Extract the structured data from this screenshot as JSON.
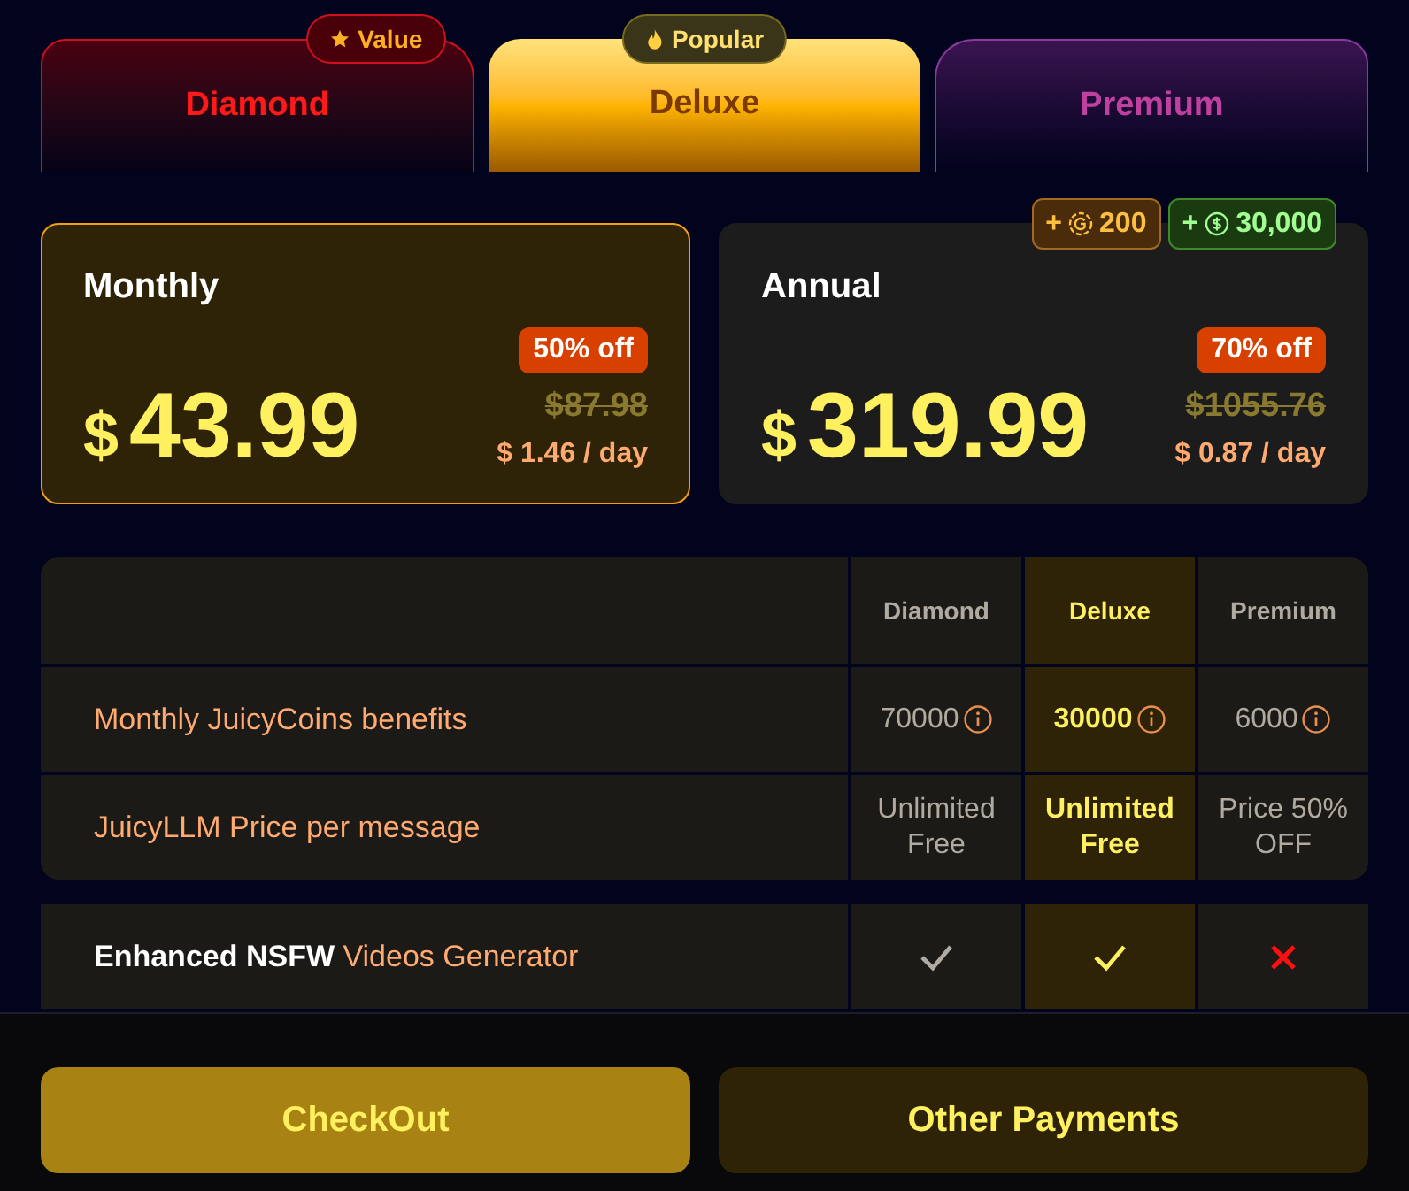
{
  "tabs": [
    {
      "label": "Diamond",
      "selected": false,
      "color": "#ff1a1a",
      "badge": {
        "kind": "star",
        "text": "Value"
      }
    },
    {
      "label": "Deluxe",
      "selected": true,
      "color": "#7a3a00",
      "badge": {
        "kind": "fire",
        "text": "Popular"
      }
    },
    {
      "label": "Premium",
      "selected": false,
      "color": "#c040a0"
    }
  ],
  "plans": [
    {
      "name": "Monthly",
      "selected": true,
      "currency": "$",
      "price": "43.99",
      "discount": "50% off",
      "old_price": "$87.98",
      "per_day": "$ 1.46 / day"
    },
    {
      "name": "Annual",
      "selected": false,
      "currency": "$",
      "price": "319.99",
      "discount": "70% off",
      "old_price": "$1055.76",
      "per_day": "$ 0.87 / day",
      "bonuses": [
        {
          "kind": "gold",
          "text": "+",
          "amount": "200"
        },
        {
          "kind": "cash",
          "text": "+",
          "amount": "30,000"
        }
      ]
    }
  ],
  "table": {
    "columns": [
      {
        "label": "Diamond",
        "selected": false
      },
      {
        "label": "Deluxe",
        "selected": true
      },
      {
        "label": "Premium",
        "selected": false
      }
    ],
    "rows": [
      {
        "label": "Monthly JuicyCoins benefits",
        "cells": [
          {
            "kind": "text",
            "text": "70000",
            "info": true
          },
          {
            "kind": "text",
            "text": "30000",
            "info": true
          },
          {
            "kind": "text",
            "text": "6000",
            "info": true
          }
        ]
      },
      {
        "label": "JuicyLLM Price per message",
        "cells": [
          {
            "kind": "text",
            "text": "Unlimited Free"
          },
          {
            "kind": "text",
            "text": "Unlimited Free"
          },
          {
            "kind": "text",
            "text": "Price 50% OFF"
          }
        ]
      }
    ],
    "feature_rows": [
      {
        "label": "Enhanced NSFW",
        "label_accent": "Videos Generator",
        "cells": [
          {
            "kind": "check"
          },
          {
            "kind": "check"
          },
          {
            "kind": "cross"
          }
        ]
      }
    ]
  },
  "buttons": [
    {
      "label": "CheckOut",
      "kind": "primary"
    },
    {
      "label": "Other Payments",
      "kind": "secondary"
    }
  ]
}
